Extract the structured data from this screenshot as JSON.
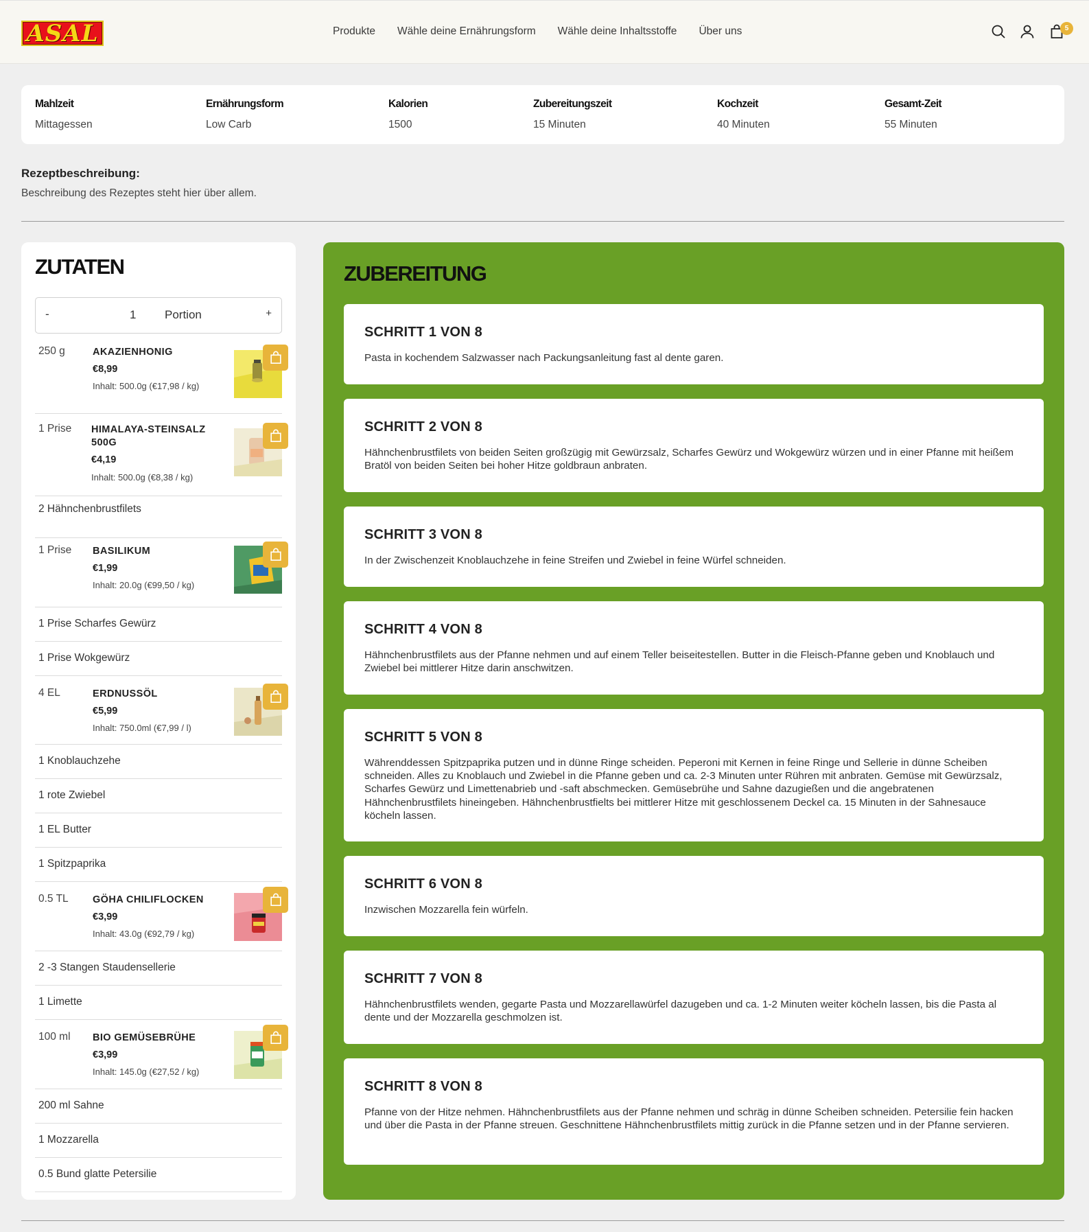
{
  "header": {
    "logo_text": "ASAL",
    "nav": [
      "Produkte",
      "Wähle deine Ernährungsform",
      "Wähle deine Inhaltsstoffe",
      "Über uns"
    ],
    "cart_count": "5",
    "icons": [
      "search-icon",
      "account-icon",
      "cart-icon"
    ]
  },
  "info": [
    {
      "label": "Mahlzeit",
      "value": "Mittagessen"
    },
    {
      "label": "Ernährungsform",
      "value": "Low Carb"
    },
    {
      "label": "Kalorien",
      "value": "1500"
    },
    {
      "label": "Zubereitungszeit",
      "value": "15 Minuten"
    },
    {
      "label": "Kochzeit",
      "value": "40 Minuten"
    },
    {
      "label": "Gesamt-Zeit",
      "value": "55 Minuten"
    }
  ],
  "description": {
    "title": "Rezeptbeschreibung:",
    "text": "Beschreibung des Rezeptes steht hier über allem."
  },
  "ingredients": {
    "title": "ZUTATEN",
    "portion": {
      "minus": "-",
      "qty": "1",
      "unit": "Portion",
      "plus": "+"
    },
    "items": [
      {
        "amount": "250 g",
        "name": "AKAZIENHONIG",
        "price": "€8,99",
        "content": "Inhalt: 500.0g (€17,98 / kg)"
      },
      {
        "amount": "1 Prise",
        "name": "HIMALAYA-STEINSALZ 500G",
        "price": "€4,19",
        "content": "Inhalt: 500.0g (€8,38 / kg)"
      },
      {
        "text": "2 Hähnchenbrustfilets"
      },
      {
        "amount": "1 Prise",
        "name": "BASILIKUM",
        "price": "€1,99",
        "content": "Inhalt: 20.0g (€99,50 / kg)"
      },
      {
        "text": "1 Prise Scharfes Gewürz"
      },
      {
        "text": "1 Prise Wokgewürz"
      },
      {
        "amount": "4 EL",
        "name": "ERDNUSSÖL",
        "price": "€5,99",
        "content": "Inhalt: 750.0ml (€7,99 / l)"
      },
      {
        "text": "1 Knoblauchzehe"
      },
      {
        "text": "1 rote Zwiebel"
      },
      {
        "text": "1 EL Butter"
      },
      {
        "text": "1 Spitzpaprika"
      },
      {
        "amount": "0.5 TL",
        "name": "GÖHA CHILIFLOCKEN",
        "price": "€3,99",
        "content": "Inhalt: 43.0g (€92,79 / kg)"
      },
      {
        "text": "2 -3 Stangen Staudensellerie"
      },
      {
        "text": "1 Limette"
      },
      {
        "amount": "100 ml",
        "name": "BIO GEMÜSEBRÜHE",
        "price": "€3,99",
        "content": "Inhalt: 145.0g (€27,52 / kg)"
      },
      {
        "text": "200 ml Sahne"
      },
      {
        "text": "1 Mozzarella"
      },
      {
        "text": "0.5 Bund glatte Petersilie"
      }
    ]
  },
  "preparation": {
    "title": "ZUBEREITUNG",
    "steps": [
      {
        "title": "SCHRITT 1 VON 8",
        "text": "Pasta in kochendem Salzwasser nach Packungsanleitung fast al dente garen."
      },
      {
        "title": "SCHRITT 2 VON 8",
        "text": "Hähnchenbrustfilets von beiden Seiten großzügig mit Gewürzsalz, Scharfes Gewürz und Wokgewürz würzen und in einer Pfanne mit heißem Bratöl von beiden Seiten bei hoher Hitze goldbraun anbraten."
      },
      {
        "title": "SCHRITT 3 VON 8",
        "text": "In der Zwischenzeit Knoblauchzehe in feine Streifen und Zwiebel in feine Würfel schneiden."
      },
      {
        "title": "SCHRITT 4 VON 8",
        "text": "Hähnchenbrustfilets aus der Pfanne nehmen und auf einem Teller beiseitestellen. Butter in die Fleisch-Pfanne geben und Knoblauch und Zwiebel bei mittlerer Hitze darin anschwitzen."
      },
      {
        "title": "SCHRITT 5 VON 8",
        "text": "Währenddessen Spitzpaprika putzen und in dünne Ringe scheiden. Peperoni mit Kernen in feine Ringe und Sellerie in dünne Scheiben schneiden. Alles zu Knoblauch und Zwiebel in die Pfanne geben und ca. 2-3 Minuten unter Rühren mit anbraten. Gemüse mit Gewürzsalz, Scharfes Gewürz und Limettenabrieb und -saft abschmecken. Gemüsebrühe und Sahne dazugießen und die angebratenen Hähnchenbrustfilets hineingeben. Hähnchenbrustfielts bei mittlerer Hitze mit geschlossenem Deckel ca. 15 Minuten in der Sahnesauce köcheln lassen."
      },
      {
        "title": "SCHRITT 6 VON 8",
        "text": "Inzwischen Mozzarella fein würfeln."
      },
      {
        "title": "SCHRITT 7 VON 8",
        "text": "Hähnchenbrustfilets wenden, gegarte Pasta und Mozzarellawürfel dazugeben und ca. 1-2 Minuten weiter köcheln lassen, bis die Pasta al dente und der Mozzarella geschmolzen ist."
      },
      {
        "title": "SCHRITT 8 VON 8",
        "text": "Pfanne von der Hitze nehmen. Hähnchenbrustfilets aus der Pfanne nehmen und schräg in dünne Scheiben schneiden. Petersilie fein hacken und über die Pasta in der Pfanne streuen. Geschnittene Hähnchenbrustfilets mittig zurück in die Pfanne setzen und in der Pfanne servieren."
      }
    ]
  },
  "colors": {
    "accent": "#e8b43a",
    "prep_bg": "#69a026",
    "logo_red": "#e8111b",
    "logo_yellow": "#f5d716"
  }
}
